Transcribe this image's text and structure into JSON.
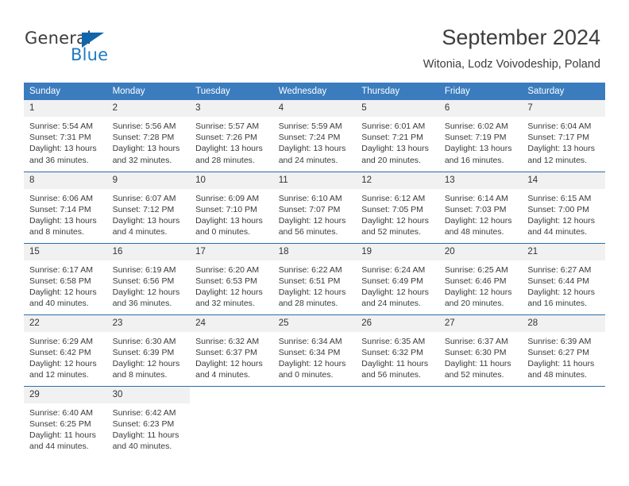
{
  "brand": {
    "name_part1": "General",
    "name_part2": "Blue",
    "triangle_color": "#1065ab",
    "blue_color": "#1f7ac4"
  },
  "header": {
    "title": "September 2024",
    "subtitle": "Witonia, Lodz Voivodeship, Poland"
  },
  "colors": {
    "header_bg": "#3a7cbe",
    "daynum_bg": "#f1f1f1",
    "row_divider": "#2a6ead",
    "text": "#3a3a3a"
  },
  "weekday_headers": [
    "Sunday",
    "Monday",
    "Tuesday",
    "Wednesday",
    "Thursday",
    "Friday",
    "Saturday"
  ],
  "weeks": [
    [
      {
        "day": "1",
        "sunrise": "Sunrise: 5:54 AM",
        "sunset": "Sunset: 7:31 PM",
        "daylight": "Daylight: 13 hours and 36 minutes."
      },
      {
        "day": "2",
        "sunrise": "Sunrise: 5:56 AM",
        "sunset": "Sunset: 7:28 PM",
        "daylight": "Daylight: 13 hours and 32 minutes."
      },
      {
        "day": "3",
        "sunrise": "Sunrise: 5:57 AM",
        "sunset": "Sunset: 7:26 PM",
        "daylight": "Daylight: 13 hours and 28 minutes."
      },
      {
        "day": "4",
        "sunrise": "Sunrise: 5:59 AM",
        "sunset": "Sunset: 7:24 PM",
        "daylight": "Daylight: 13 hours and 24 minutes."
      },
      {
        "day": "5",
        "sunrise": "Sunrise: 6:01 AM",
        "sunset": "Sunset: 7:21 PM",
        "daylight": "Daylight: 13 hours and 20 minutes."
      },
      {
        "day": "6",
        "sunrise": "Sunrise: 6:02 AM",
        "sunset": "Sunset: 7:19 PM",
        "daylight": "Daylight: 13 hours and 16 minutes."
      },
      {
        "day": "7",
        "sunrise": "Sunrise: 6:04 AM",
        "sunset": "Sunset: 7:17 PM",
        "daylight": "Daylight: 13 hours and 12 minutes."
      }
    ],
    [
      {
        "day": "8",
        "sunrise": "Sunrise: 6:06 AM",
        "sunset": "Sunset: 7:14 PM",
        "daylight": "Daylight: 13 hours and 8 minutes."
      },
      {
        "day": "9",
        "sunrise": "Sunrise: 6:07 AM",
        "sunset": "Sunset: 7:12 PM",
        "daylight": "Daylight: 13 hours and 4 minutes."
      },
      {
        "day": "10",
        "sunrise": "Sunrise: 6:09 AM",
        "sunset": "Sunset: 7:10 PM",
        "daylight": "Daylight: 13 hours and 0 minutes."
      },
      {
        "day": "11",
        "sunrise": "Sunrise: 6:10 AM",
        "sunset": "Sunset: 7:07 PM",
        "daylight": "Daylight: 12 hours and 56 minutes."
      },
      {
        "day": "12",
        "sunrise": "Sunrise: 6:12 AM",
        "sunset": "Sunset: 7:05 PM",
        "daylight": "Daylight: 12 hours and 52 minutes."
      },
      {
        "day": "13",
        "sunrise": "Sunrise: 6:14 AM",
        "sunset": "Sunset: 7:03 PM",
        "daylight": "Daylight: 12 hours and 48 minutes."
      },
      {
        "day": "14",
        "sunrise": "Sunrise: 6:15 AM",
        "sunset": "Sunset: 7:00 PM",
        "daylight": "Daylight: 12 hours and 44 minutes."
      }
    ],
    [
      {
        "day": "15",
        "sunrise": "Sunrise: 6:17 AM",
        "sunset": "Sunset: 6:58 PM",
        "daylight": "Daylight: 12 hours and 40 minutes."
      },
      {
        "day": "16",
        "sunrise": "Sunrise: 6:19 AM",
        "sunset": "Sunset: 6:56 PM",
        "daylight": "Daylight: 12 hours and 36 minutes."
      },
      {
        "day": "17",
        "sunrise": "Sunrise: 6:20 AM",
        "sunset": "Sunset: 6:53 PM",
        "daylight": "Daylight: 12 hours and 32 minutes."
      },
      {
        "day": "18",
        "sunrise": "Sunrise: 6:22 AM",
        "sunset": "Sunset: 6:51 PM",
        "daylight": "Daylight: 12 hours and 28 minutes."
      },
      {
        "day": "19",
        "sunrise": "Sunrise: 6:24 AM",
        "sunset": "Sunset: 6:49 PM",
        "daylight": "Daylight: 12 hours and 24 minutes."
      },
      {
        "day": "20",
        "sunrise": "Sunrise: 6:25 AM",
        "sunset": "Sunset: 6:46 PM",
        "daylight": "Daylight: 12 hours and 20 minutes."
      },
      {
        "day": "21",
        "sunrise": "Sunrise: 6:27 AM",
        "sunset": "Sunset: 6:44 PM",
        "daylight": "Daylight: 12 hours and 16 minutes."
      }
    ],
    [
      {
        "day": "22",
        "sunrise": "Sunrise: 6:29 AM",
        "sunset": "Sunset: 6:42 PM",
        "daylight": "Daylight: 12 hours and 12 minutes."
      },
      {
        "day": "23",
        "sunrise": "Sunrise: 6:30 AM",
        "sunset": "Sunset: 6:39 PM",
        "daylight": "Daylight: 12 hours and 8 minutes."
      },
      {
        "day": "24",
        "sunrise": "Sunrise: 6:32 AM",
        "sunset": "Sunset: 6:37 PM",
        "daylight": "Daylight: 12 hours and 4 minutes."
      },
      {
        "day": "25",
        "sunrise": "Sunrise: 6:34 AM",
        "sunset": "Sunset: 6:34 PM",
        "daylight": "Daylight: 12 hours and 0 minutes."
      },
      {
        "day": "26",
        "sunrise": "Sunrise: 6:35 AM",
        "sunset": "Sunset: 6:32 PM",
        "daylight": "Daylight: 11 hours and 56 minutes."
      },
      {
        "day": "27",
        "sunrise": "Sunrise: 6:37 AM",
        "sunset": "Sunset: 6:30 PM",
        "daylight": "Daylight: 11 hours and 52 minutes."
      },
      {
        "day": "28",
        "sunrise": "Sunrise: 6:39 AM",
        "sunset": "Sunset: 6:27 PM",
        "daylight": "Daylight: 11 hours and 48 minutes."
      }
    ],
    [
      {
        "day": "29",
        "sunrise": "Sunrise: 6:40 AM",
        "sunset": "Sunset: 6:25 PM",
        "daylight": "Daylight: 11 hours and 44 minutes."
      },
      {
        "day": "30",
        "sunrise": "Sunrise: 6:42 AM",
        "sunset": "Sunset: 6:23 PM",
        "daylight": "Daylight: 11 hours and 40 minutes."
      },
      {
        "day": "",
        "sunrise": "",
        "sunset": "",
        "daylight": ""
      },
      {
        "day": "",
        "sunrise": "",
        "sunset": "",
        "daylight": ""
      },
      {
        "day": "",
        "sunrise": "",
        "sunset": "",
        "daylight": ""
      },
      {
        "day": "",
        "sunrise": "",
        "sunset": "",
        "daylight": ""
      },
      {
        "day": "",
        "sunrise": "",
        "sunset": "",
        "daylight": ""
      }
    ]
  ]
}
